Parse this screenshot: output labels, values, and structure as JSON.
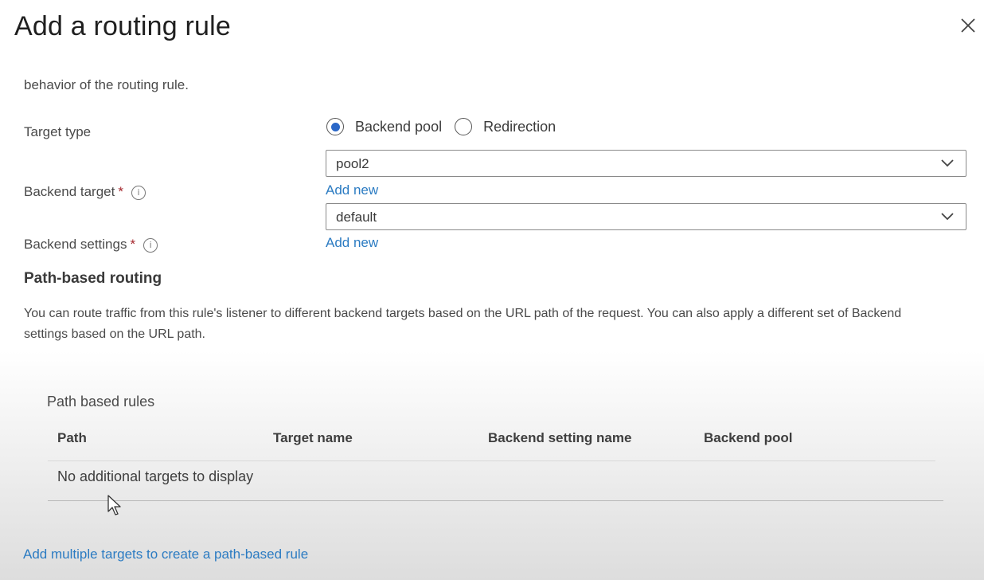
{
  "panel": {
    "title": "Add a routing rule",
    "intro_text": "behavior of the routing rule."
  },
  "target_type": {
    "label": "Target type",
    "options": [
      {
        "label": "Backend pool",
        "selected": true
      },
      {
        "label": "Redirection",
        "selected": false
      }
    ]
  },
  "backend_target": {
    "label": "Backend target",
    "required_mark": "*",
    "value": "pool2",
    "add_new": "Add new"
  },
  "backend_settings": {
    "label": "Backend settings",
    "required_mark": "*",
    "value": "default",
    "add_new": "Add new"
  },
  "path_routing": {
    "heading": "Path-based routing",
    "description": "You can route traffic from this rule's listener to different backend targets based on the URL path of the request. You can also apply a different set of Backend settings based on the URL path.",
    "table_title": "Path based rules",
    "columns": [
      "Path",
      "Target name",
      "Backend setting name",
      "Backend pool"
    ],
    "empty_message": "No additional targets to display",
    "add_link": "Add multiple targets to create a path-based rule"
  },
  "colors": {
    "accent": "#2a67c8",
    "link": "#2b7bc2",
    "required": "#a4262c"
  },
  "icons": {
    "close": "close-icon",
    "info": "info-icon",
    "dropdown": "chevron-down-icon",
    "cursor": "mouse-pointer-icon"
  }
}
